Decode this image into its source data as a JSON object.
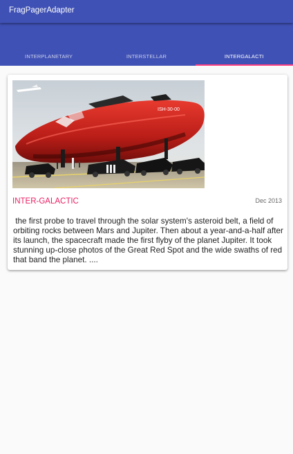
{
  "toolbar": {
    "title": "FragPagerAdapter",
    "background_color": "#3f51b5"
  },
  "tabs": {
    "items": [
      {
        "label": "INTERPLANETARY",
        "selected": false
      },
      {
        "label": "INTERSTELLAR",
        "selected": false
      },
      {
        "label": "INTERGALACTI",
        "selected": true
      }
    ],
    "indicator_color": "#ff4081",
    "annotation_arrow_color": "#e53935"
  },
  "card": {
    "image_icon": "spaceship-photo",
    "title": "INTER-GALACTIC",
    "date": "Dec 2013",
    "body": " the first probe to travel through the solar system's asteroid belt, a field of orbiting rocks between Mars and Jupiter. Then about a year-and-a-half after its launch, the spacecraft made the first flyby of the planet Jupiter. It took stunning up-close photos of the Great Red Spot and the wide swaths of red that band the planet. ....",
    "title_color": "#e91e63"
  }
}
